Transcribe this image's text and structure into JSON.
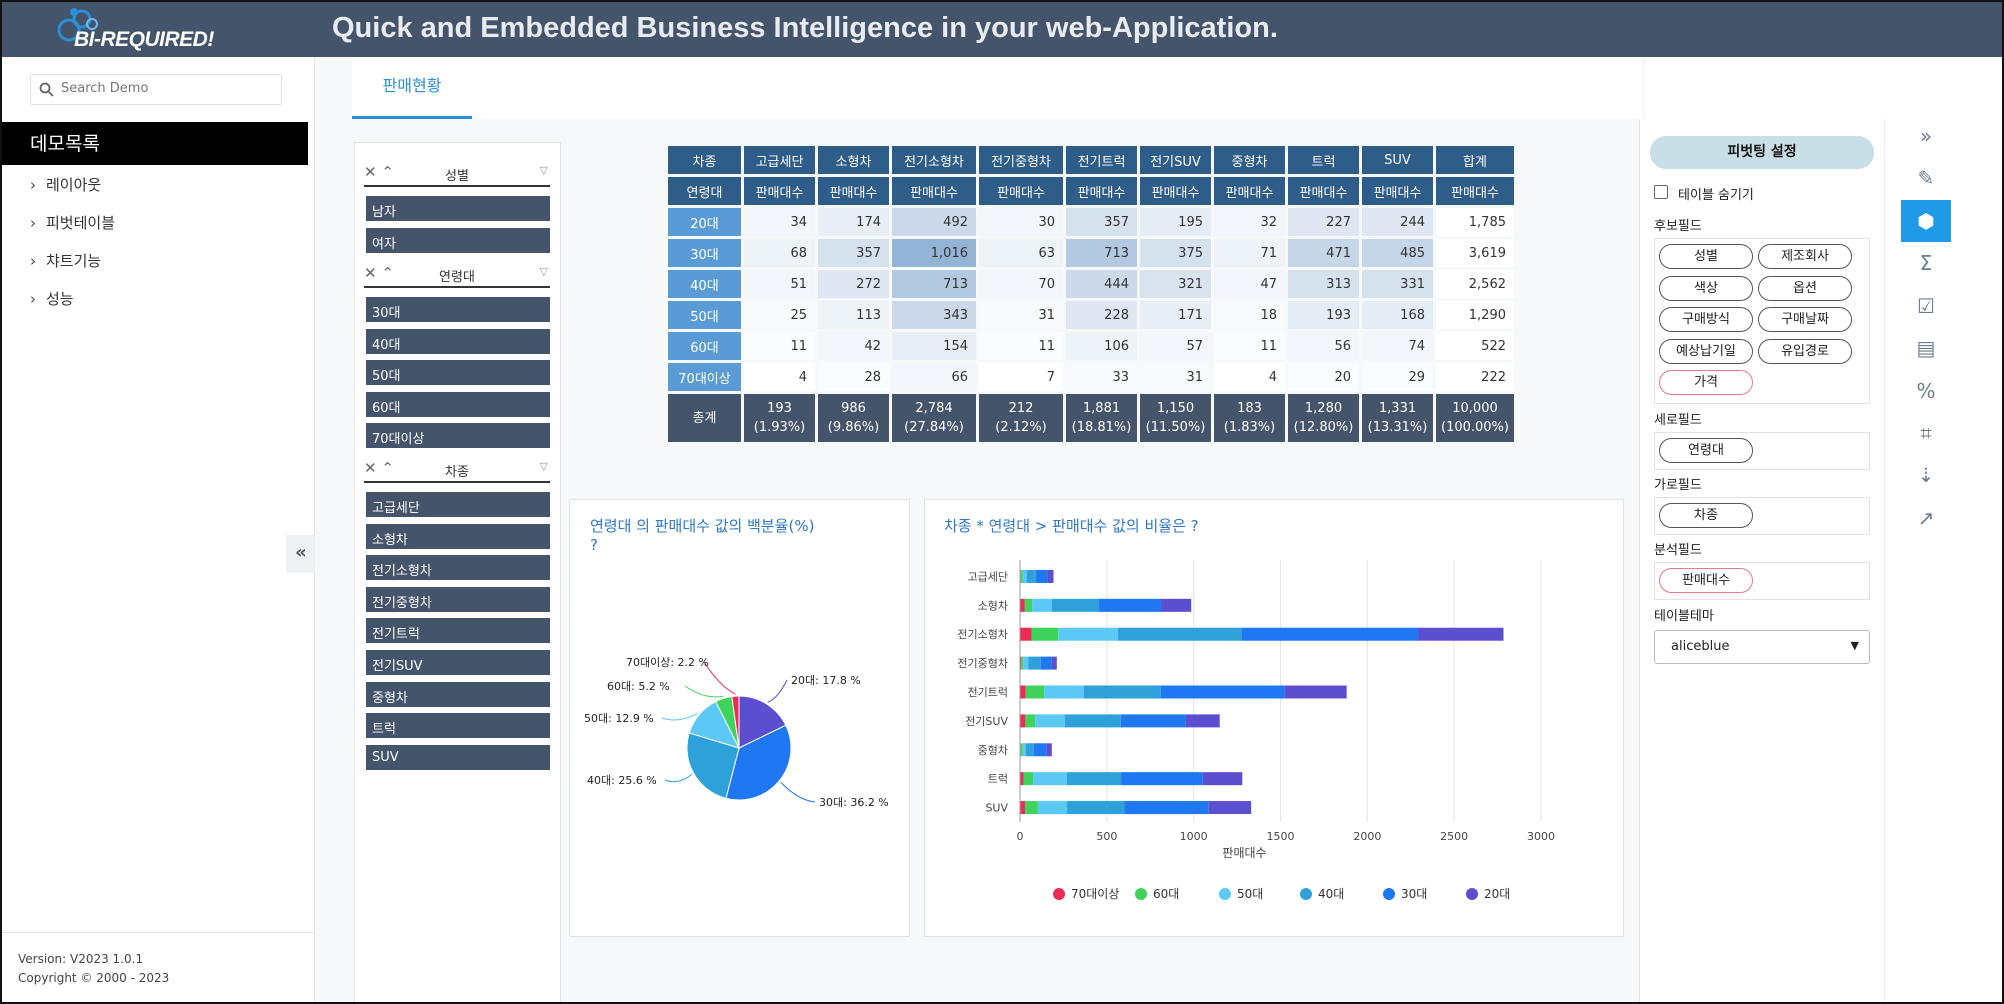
{
  "header": {
    "logo_text": "BI-REQUIRED!",
    "tagline": "Quick and Embedded Business Intelligence in your web-Application."
  },
  "sidebar": {
    "search_placeholder": "Search Demo",
    "title": "데모목록",
    "items": [
      {
        "label": "레이아웃"
      },
      {
        "label": "피벗테이블"
      },
      {
        "label": "챠트기능"
      },
      {
        "label": "성능"
      }
    ],
    "version": "Version: V2023 1.0.1",
    "copyright": "Copyright © 2000 - 2023"
  },
  "tabs": [
    {
      "label": "판매현황"
    }
  ],
  "filters": {
    "gender": {
      "title": "성별",
      "items": [
        "남자",
        "여자"
      ]
    },
    "age": {
      "title": "연령대",
      "items": [
        "30대",
        "40대",
        "50대",
        "60대",
        "70대이상"
      ]
    },
    "car": {
      "title": "차종",
      "items": [
        "고급세단",
        "소형차",
        "전기소형차",
        "전기중형차",
        "전기트럭",
        "전기SUV",
        "중형차",
        "트럭",
        "SUV"
      ]
    }
  },
  "pivot": {
    "corner_top": "차종",
    "corner_bottom": "연령대",
    "columns": [
      "고급세단",
      "소형차",
      "전기소형차",
      "전기중형차",
      "전기트럭",
      "전기SUV",
      "중형차",
      "트럭",
      "SUV",
      "합계"
    ],
    "measure": "판매대수",
    "rows": [
      {
        "label": "20대",
        "values": [
          "34",
          "174",
          "492",
          "30",
          "357",
          "195",
          "32",
          "227",
          "244",
          "1,785"
        ]
      },
      {
        "label": "30대",
        "values": [
          "68",
          "357",
          "1,016",
          "63",
          "713",
          "375",
          "71",
          "471",
          "485",
          "3,619"
        ]
      },
      {
        "label": "40대",
        "values": [
          "51",
          "272",
          "713",
          "70",
          "444",
          "321",
          "47",
          "313",
          "331",
          "2,562"
        ]
      },
      {
        "label": "50대",
        "values": [
          "25",
          "113",
          "343",
          "31",
          "228",
          "171",
          "18",
          "193",
          "168",
          "1,290"
        ]
      },
      {
        "label": "60대",
        "values": [
          "11",
          "42",
          "154",
          "11",
          "106",
          "57",
          "11",
          "56",
          "74",
          "522"
        ]
      },
      {
        "label": "70대이상",
        "values": [
          "4",
          "28",
          "66",
          "7",
          "33",
          "31",
          "4",
          "20",
          "29",
          "222"
        ]
      }
    ],
    "total_label": "총계",
    "totals": [
      [
        "193",
        "(1.93%)"
      ],
      [
        "986",
        "(9.86%)"
      ],
      [
        "2,784",
        "(27.84%)"
      ],
      [
        "212",
        "(2.12%)"
      ],
      [
        "1,881",
        "(18.81%)"
      ],
      [
        "1,150",
        "(11.50%)"
      ],
      [
        "183",
        "(1.83%)"
      ],
      [
        "1,280",
        "(12.80%)"
      ],
      [
        "1,331",
        "(13.31%)"
      ],
      [
        "10,000",
        "(100.00%)"
      ]
    ]
  },
  "chart_data": [
    {
      "type": "pie",
      "title": "연령대 의 판매대수 값의 백분율(%)\n?",
      "title_line1": "연령대 의 판매대수 값의 백분율(%)",
      "title_line2": "?",
      "categories": [
        "20대",
        "30대",
        "40대",
        "50대",
        "60대",
        "70대이상"
      ],
      "values": [
        17.8,
        36.2,
        25.6,
        12.9,
        5.2,
        2.2
      ],
      "labels": [
        "20대: 17.8 %",
        "30대: 36.2 %",
        "40대: 25.6 %",
        "50대: 12.9 %",
        "60대: 5.2 %",
        "70대이상: 2.2 %"
      ],
      "colors": [
        "#5b4fcf",
        "#1f77f2",
        "#2ea1da",
        "#5cc8f5",
        "#3ed35a",
        "#ee2b55"
      ]
    },
    {
      "type": "bar",
      "orientation": "horizontal",
      "stacked": true,
      "title": "차종 * 연령대 > 판매대수 값의 비율은 ?",
      "xlabel": "판매대수",
      "xlim": [
        0,
        3000
      ],
      "xticks": [
        "0",
        "500",
        "1000",
        "1500",
        "2000",
        "2500",
        "3000"
      ],
      "grid": true,
      "legend_position": "bottom",
      "categories": [
        "고급세단",
        "소형차",
        "전기소형차",
        "전기중형차",
        "전기트럭",
        "전기SUV",
        "중형차",
        "트럭",
        "SUV"
      ],
      "series": [
        {
          "name": "70대이상",
          "color": "#ee2b55",
          "values": [
            4,
            28,
            66,
            7,
            33,
            31,
            4,
            20,
            29
          ]
        },
        {
          "name": "60대",
          "color": "#3ed35a",
          "values": [
            11,
            42,
            154,
            11,
            106,
            57,
            11,
            56,
            74
          ]
        },
        {
          "name": "50대",
          "color": "#5cc8f5",
          "values": [
            25,
            113,
            343,
            31,
            228,
            171,
            18,
            193,
            168
          ]
        },
        {
          "name": "40대",
          "color": "#2ea1da",
          "values": [
            51,
            272,
            713,
            70,
            444,
            321,
            47,
            313,
            331
          ]
        },
        {
          "name": "30대",
          "color": "#1f77f2",
          "values": [
            68,
            357,
            1016,
            63,
            713,
            375,
            71,
            471,
            485
          ]
        },
        {
          "name": "20대",
          "color": "#5b4fcf",
          "values": [
            34,
            174,
            492,
            30,
            357,
            195,
            32,
            227,
            244
          ]
        }
      ]
    }
  ],
  "right_panel": {
    "button": "피벗팅 설정",
    "hide_table_label": "테이블 숨기기",
    "hide_table_checked": false,
    "candidate_label": "후보필드",
    "candidates": [
      "성별",
      "제조회사",
      "색상",
      "옵션",
      "구매방식",
      "구매날짜",
      "예상납기일",
      "유입경로",
      "가격"
    ],
    "row_label": "세로필드",
    "row_fields": [
      "연령대"
    ],
    "col_label": "가로필드",
    "col_fields": [
      "차종"
    ],
    "value_label": "분석필드",
    "value_fields": [
      "판매대수"
    ],
    "theme_label": "테이블테마",
    "theme_value": "aliceblue"
  },
  "toolbar": {
    "icons": [
      "expand-icon",
      "edit-icon",
      "cube-icon",
      "sum-icon",
      "checklist-icon",
      "layout-icon",
      "percent-icon",
      "crop-icon",
      "sort-icon",
      "chart-icon"
    ],
    "active": "cube-icon"
  }
}
